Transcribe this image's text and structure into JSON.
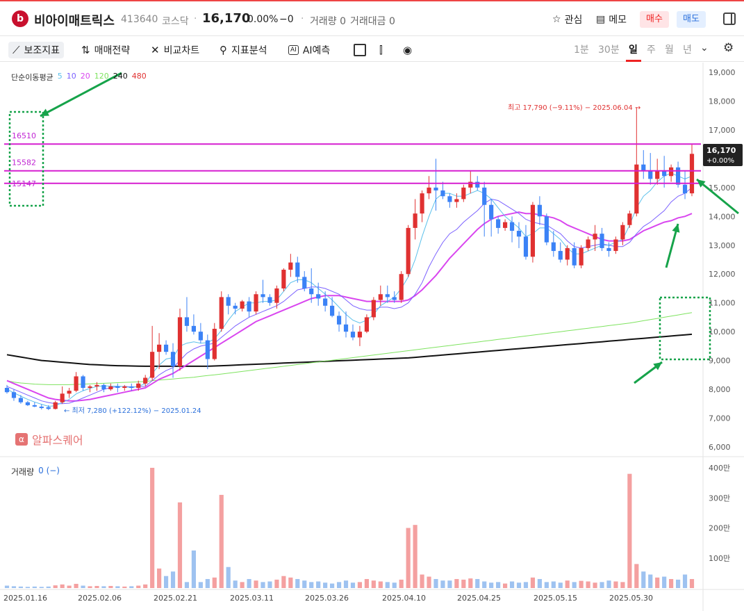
{
  "header": {
    "name": "비아이매트릭스",
    "code": "413640",
    "market": "코스닥",
    "price": "16,170",
    "change_pct": "0.00%",
    "change_abs": "−0",
    "volume": "거래량 0",
    "amount": "거래대금 0",
    "watch_label": "관심",
    "memo_label": "메모",
    "buy_label": "매수",
    "sell_label": "매도"
  },
  "toolbar": {
    "items": [
      "보조지표",
      "매매전략",
      "비교차트",
      "지표분석",
      "AI예측"
    ],
    "timeframes": [
      "1분",
      "30분",
      "일",
      "주",
      "월",
      "년"
    ],
    "selected_timeframe": "일"
  },
  "legend": {
    "ma_title": "단순이동평균",
    "periods": [
      "5",
      "10",
      "20",
      "120",
      "240",
      "480"
    ],
    "volume_title": "거래량",
    "volume_value": "0 (−)"
  },
  "watermark": "알파스퀘어",
  "annotations": {
    "high": "최고 17,790 (−9.11%) − 2025.06.04 →",
    "low": "← 최저 7,280 (+122.12%) − 2025.01.24",
    "levels": [
      "16510",
      "15582",
      "15147"
    ],
    "price_tag": "16,170",
    "price_tag_change": "+0.00%"
  },
  "colors": {
    "up": "#e03131",
    "down": "#3b82f6",
    "ma5": "#5bc0eb",
    "ma10": "#7b61ff",
    "ma20": "#d946ef",
    "ma120": "#7ee35f",
    "ma240": "#111111",
    "hline": "#d61fd0",
    "arrow": "#16a34a"
  },
  "chart_data": {
    "type": "candlestick",
    "price_axis": [
      "19,000",
      "18,000",
      "17,000",
      "16,000",
      "15,000",
      "14,000",
      "13,000",
      "12,000",
      "11,000",
      "10,000",
      "9,000",
      "8,000",
      "7,000",
      "6,000"
    ],
    "volume_axis": [
      "400만",
      "300만",
      "200만",
      "100만"
    ],
    "x_labels": [
      "2025.01.16",
      "2025.02.06",
      "2025.02.21",
      "2025.03.11",
      "2025.03.26",
      "2025.04.10",
      "2025.04.25",
      "2025.05.15",
      "2025.05.30"
    ],
    "ohlc": [
      [
        8050,
        8150,
        7850,
        7900
      ],
      [
        7900,
        8000,
        7600,
        7700
      ],
      [
        7700,
        7800,
        7500,
        7550
      ],
      [
        7550,
        7600,
        7420,
        7450
      ],
      [
        7450,
        7550,
        7380,
        7400
      ],
      [
        7400,
        7480,
        7300,
        7350
      ],
      [
        7380,
        7450,
        7280,
        7320
      ],
      [
        7320,
        7600,
        7300,
        7550
      ],
      [
        7550,
        8100,
        7500,
        7850
      ],
      [
        7850,
        8050,
        7700,
        7950
      ],
      [
        7950,
        8600,
        7900,
        8450
      ],
      [
        8450,
        8500,
        7950,
        8050
      ],
      [
        8050,
        8150,
        7900,
        8100
      ],
      [
        8100,
        8250,
        7950,
        8150
      ],
      [
        8150,
        8200,
        7900,
        8000
      ],
      [
        8000,
        8200,
        7950,
        8100
      ],
      [
        8100,
        8200,
        7900,
        8050
      ],
      [
        8050,
        8150,
        7950,
        8100
      ],
      [
        8100,
        8200,
        7950,
        8050
      ],
      [
        8050,
        8300,
        7950,
        8200
      ],
      [
        8200,
        8500,
        8100,
        8400
      ],
      [
        8400,
        10200,
        8300,
        9300
      ],
      [
        9300,
        9950,
        8700,
        9550
      ],
      [
        9550,
        9700,
        9200,
        9300
      ],
      [
        9300,
        9600,
        8400,
        8800
      ],
      [
        8800,
        10800,
        8650,
        10500
      ],
      [
        10500,
        11200,
        10000,
        10200
      ],
      [
        10200,
        10600,
        9900,
        10000
      ],
      [
        10000,
        10300,
        9600,
        9700
      ],
      [
        9700,
        9900,
        8700,
        9050
      ],
      [
        9050,
        10300,
        9000,
        10100
      ],
      [
        10100,
        11400,
        10000,
        11200
      ],
      [
        11200,
        11300,
        10600,
        10900
      ],
      [
        10900,
        11000,
        10600,
        10800
      ],
      [
        10800,
        11100,
        10700,
        11050
      ],
      [
        11050,
        11200,
        10500,
        10700
      ],
      [
        10700,
        11400,
        10600,
        11300
      ],
      [
        11300,
        11800,
        11000,
        11200
      ],
      [
        11200,
        11300,
        10900,
        11000
      ],
      [
        11000,
        11600,
        10800,
        11500
      ],
      [
        11500,
        12200,
        11400,
        12150
      ],
      [
        12150,
        12700,
        11900,
        12400
      ],
      [
        12400,
        12600,
        11700,
        11900
      ],
      [
        11900,
        12100,
        11400,
        11500
      ],
      [
        11500,
        12200,
        11000,
        11300
      ],
      [
        11300,
        11700,
        10900,
        11150
      ],
      [
        11150,
        11400,
        10700,
        10900
      ],
      [
        10900,
        11200,
        10500,
        10550
      ],
      [
        10550,
        10700,
        10000,
        10250
      ],
      [
        10250,
        10700,
        9800,
        10000
      ],
      [
        10000,
        10250,
        9700,
        9800
      ],
      [
        9800,
        10200,
        9500,
        10000
      ],
      [
        10000,
        10600,
        9950,
        10500
      ],
      [
        10500,
        11200,
        10400,
        11100
      ],
      [
        11100,
        11600,
        10900,
        11300
      ],
      [
        11300,
        11600,
        11000,
        11200
      ],
      [
        11200,
        11400,
        11000,
        11100
      ],
      [
        11100,
        12100,
        11000,
        12000
      ],
      [
        12000,
        13700,
        11900,
        13600
      ],
      [
        13600,
        14600,
        13200,
        14100
      ],
      [
        14100,
        14900,
        13800,
        14800
      ],
      [
        14800,
        15400,
        14600,
        15000
      ],
      [
        15000,
        16000,
        14200,
        14900
      ],
      [
        14900,
        15200,
        14600,
        14700
      ],
      [
        14700,
        14800,
        14300,
        14500
      ],
      [
        14500,
        14800,
        14300,
        14600
      ],
      [
        14600,
        15100,
        14500,
        15000
      ],
      [
        15000,
        15600,
        14800,
        15200
      ],
      [
        15200,
        15400,
        14900,
        15000
      ],
      [
        15000,
        15200,
        13300,
        14400
      ],
      [
        14400,
        14600,
        13300,
        13900
      ],
      [
        13900,
        14000,
        13400,
        13600
      ],
      [
        13600,
        13900,
        13500,
        13800
      ],
      [
        13800,
        14000,
        13100,
        13500
      ],
      [
        13500,
        13800,
        12900,
        13300
      ],
      [
        13300,
        13700,
        12500,
        12600
      ],
      [
        12600,
        14500,
        12400,
        14400
      ],
      [
        14400,
        14700,
        13700,
        14000
      ],
      [
        14000,
        14100,
        13000,
        13100
      ],
      [
        13100,
        13500,
        12600,
        12800
      ],
      [
        12800,
        13100,
        12400,
        12500
      ],
      [
        12500,
        13000,
        12300,
        12900
      ],
      [
        12900,
        13100,
        12200,
        12300
      ],
      [
        12300,
        13000,
        12200,
        12900
      ],
      [
        12900,
        13300,
        12800,
        13200
      ],
      [
        13200,
        13700,
        12800,
        13400
      ],
      [
        13400,
        13600,
        12800,
        12900
      ],
      [
        12900,
        13100,
        12600,
        12800
      ],
      [
        12800,
        13300,
        12700,
        13200
      ],
      [
        13200,
        13800,
        13000,
        13700
      ],
      [
        13700,
        14200,
        13600,
        14100
      ],
      [
        14100,
        17790,
        14000,
        15800
      ],
      [
        15800,
        16300,
        15300,
        15600
      ],
      [
        15600,
        16200,
        15100,
        15300
      ],
      [
        15300,
        16000,
        15100,
        15600
      ],
      [
        15600,
        16100,
        15000,
        15400
      ],
      [
        15400,
        15800,
        15200,
        15700
      ],
      [
        15700,
        15900,
        15000,
        15100
      ],
      [
        15100,
        15600,
        14600,
        14800
      ],
      [
        14800,
        16500,
        14700,
        16170
      ]
    ],
    "volume": [
      8,
      6,
      5,
      4,
      5,
      4,
      5,
      9,
      12,
      8,
      14,
      8,
      6,
      7,
      6,
      7,
      6,
      5,
      6,
      8,
      12,
      400,
      65,
      40,
      55,
      285,
      20,
      125,
      20,
      30,
      35,
      310,
      70,
      25,
      20,
      30,
      25,
      20,
      22,
      28,
      40,
      35,
      30,
      25,
      20,
      22,
      18,
      15,
      20,
      25,
      18,
      20,
      30,
      25,
      22,
      20,
      18,
      28,
      200,
      210,
      45,
      38,
      30,
      25,
      25,
      30,
      28,
      32,
      30,
      22,
      18,
      20,
      15,
      22,
      18,
      20,
      35,
      30,
      20,
      22,
      18,
      25,
      20,
      24,
      22,
      18,
      20,
      25,
      22,
      20,
      380,
      80,
      55,
      45,
      35,
      38,
      30,
      28,
      45,
      30
    ],
    "ma5": [
      8000,
      7880,
      7760,
      7650,
      7560,
      7480,
      7410,
      7430,
      7540,
      7650,
      7840,
      7950,
      8030,
      8100,
      8120,
      8110,
      8110,
      8090,
      8060,
      8100,
      8200,
      8550,
      8840,
      9050,
      9100,
      9500,
      9600,
      9650,
      9600,
      9620,
      9750,
      10050,
      10400,
      10700,
      10850,
      11000,
      11000,
      11050,
      11050,
      11100,
      11400,
      11700,
      11800,
      11800,
      11700,
      11500,
      11300,
      11100,
      10850,
      10600,
      10400,
      10300,
      10400,
      10600,
      10900,
      11050,
      11200,
      11500,
      11900,
      12500,
      13300,
      14000,
      14600,
      14800,
      14800,
      14700,
      14700,
      14800,
      14900,
      14800,
      14600,
      14300,
      14000,
      13800,
      13600,
      13300,
      13400,
      13600,
      13600,
      13400,
      13200,
      12900,
      12700,
      12700,
      12800,
      12900,
      13000,
      13000,
      13100,
      13200,
      13700,
      14300,
      14700,
      14900,
      15200,
      15400,
      15500,
      15400,
      15300,
      15400
    ],
    "ma10": [
      8100,
      8000,
      7900,
      7800,
      7700,
      7600,
      7540,
      7500,
      7500,
      7520,
      7600,
      7700,
      7800,
      7900,
      8000,
      8060,
      8090,
      8100,
      8080,
      8090,
      8100,
      8300,
      8500,
      8650,
      8750,
      9000,
      9250,
      9400,
      9500,
      9550,
      9600,
      9800,
      10000,
      10200,
      10350,
      10500,
      10600,
      10700,
      10800,
      10900,
      11050,
      11250,
      11450,
      11500,
      11550,
      11550,
      11500,
      11400,
      11300,
      11100,
      10900,
      10800,
      10750,
      10750,
      10850,
      10850,
      10800,
      10850,
      11000,
      11300,
      11700,
      12250,
      12700,
      13100,
      13400,
      13550,
      13800,
      14000,
      14200,
      14450,
      14600,
      14550,
      14400,
      14250,
      14100,
      13900,
      13800,
      13750,
      13700,
      13550,
      13400,
      13150,
      12950,
      12900,
      12950,
      13000,
      13050,
      13000,
      12950,
      12950,
      13100,
      13400,
      13650,
      13800,
      14000,
      14200,
      14500,
      14700,
      14800,
      15000
    ],
    "ma20": [
      8300,
      8200,
      8100,
      8000,
      7900,
      7800,
      7700,
      7650,
      7620,
      7600,
      7600,
      7620,
      7650,
      7700,
      7750,
      7800,
      7850,
      7900,
      7950,
      8000,
      8050,
      8200,
      8350,
      8450,
      8550,
      8700,
      8850,
      9000,
      9150,
      9300,
      9450,
      9600,
      9750,
      9900,
      10050,
      10200,
      10350,
      10450,
      10550,
      10650,
      10750,
      10850,
      10950,
      11050,
      11150,
      11200,
      11250,
      11250,
      11250,
      11200,
      11150,
      11100,
      11050,
      11050,
      11050,
      11050,
      11050,
      11050,
      11100,
      11250,
      11450,
      11700,
      11950,
      12250,
      12550,
      12800,
      13050,
      13300,
      13550,
      13750,
      13900,
      14000,
      14050,
      14100,
      14150,
      14100,
      14100,
      14050,
      14000,
      13950,
      13850,
      13700,
      13600,
      13500,
      13400,
      13300,
      13200,
      13150,
      13150,
      13150,
      13200,
      13350,
      13500,
      13600,
      13700,
      13800,
      13850,
      13950,
      14000,
      14100
    ],
    "ma120": [
      8300,
      8250,
      8220,
      8200,
      8180,
      8170,
      8160,
      8160,
      8160,
      8160,
      8170,
      8180,
      8190,
      8200,
      8210,
      8220,
      8230,
      8240,
      8250,
      8260,
      8270,
      8300,
      8320,
      8340,
      8360,
      8380,
      8400,
      8420,
      8450,
      8480,
      8500,
      8530,
      8560,
      8590,
      8620,
      8650,
      8680,
      8710,
      8740,
      8770,
      8800,
      8830,
      8860,
      8890,
      8920,
      8950,
      8980,
      9010,
      9040,
      9070,
      9100,
      9130,
      9160,
      9190,
      9220,
      9250,
      9280,
      9310,
      9340,
      9370,
      9400,
      9430,
      9460,
      9490,
      9520,
      9550,
      9580,
      9610,
      9640,
      9670,
      9700,
      9730,
      9760,
      9790,
      9820,
      9850,
      9880,
      9910,
      9940,
      9970,
      10000,
      10030,
      10060,
      10090,
      10120,
      10150,
      10180,
      10210,
      10240,
      10270,
      10300,
      10340,
      10380,
      10420,
      10460,
      10500,
      10540,
      10580,
      10620,
      10660
    ],
    "ma240": [
      9200,
      9160,
      9120,
      9080,
      9040,
      9000,
      8980,
      8960,
      8940,
      8920,
      8900,
      8880,
      8860,
      8850,
      8840,
      8830,
      8820,
      8815,
      8810,
      8805,
      8800,
      8800,
      8800,
      8800,
      8800,
      8800,
      8800,
      8800,
      8800,
      8800,
      8810,
      8820,
      8830,
      8840,
      8850,
      8860,
      8870,
      8880,
      8890,
      8900,
      8910,
      8920,
      8930,
      8940,
      8950,
      8960,
      8970,
      8980,
      8990,
      9000,
      9010,
      9020,
      9030,
      9040,
      9050,
      9060,
      9070,
      9080,
      9090,
      9110,
      9130,
      9150,
      9170,
      9190,
      9210,
      9230,
      9250,
      9270,
      9290,
      9310,
      9330,
      9350,
      9370,
      9390,
      9410,
      9430,
      9450,
      9470,
      9490,
      9510,
      9530,
      9550,
      9570,
      9590,
      9610,
      9630,
      9650,
      9670,
      9690,
      9710,
      9730,
      9750,
      9770,
      9790,
      9810,
      9830,
      9850,
      9870,
      9890,
      9910
    ]
  }
}
